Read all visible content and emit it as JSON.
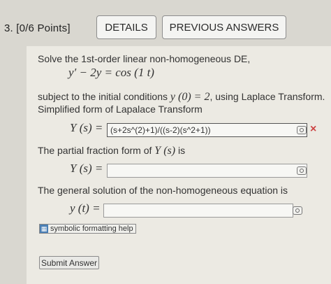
{
  "question": {
    "number_points": "3. [0/6 Points]"
  },
  "toolbar": {
    "details_label": "DETAILS",
    "previous_answers_label": "PREVIOUS ANSWERS"
  },
  "problem": {
    "intro": "Solve the 1st-order linear non-homogeneous DE,",
    "equation": "y′ − 2y = cos (1 t)",
    "conditions_prefix": "subject to the initial conditions",
    "condition": "y (0) = 2",
    "conditions_suffix": ", using Laplace Transform.",
    "simplified_label": "Simplified form of Lapalace Transform"
  },
  "answers": {
    "laplace_lhs": "Y (s) =",
    "laplace_value": "(s+2s^(2)+1)/((s-2)(s^2+1))",
    "partial_label_prefix": "The partial fraction form of",
    "partial_label_symbol": "Y (s)",
    "partial_label_suffix": "is",
    "partial_lhs": "Y (s) =",
    "partial_value": "",
    "general_label": "The general solution of the non-homogeneous equation is",
    "general_lhs": "y (t) =",
    "general_value": ""
  },
  "status": {
    "incorrect_mark": "×"
  },
  "help": {
    "label": "symbolic formatting help",
    "icon": "help-icon"
  },
  "submit": {
    "label": "Submit Answer"
  },
  "colors": {
    "background": "#d9d7d0",
    "panel": "#eceae3",
    "incorrect": "#cc4444",
    "help_icon": "#4a7fb5"
  }
}
